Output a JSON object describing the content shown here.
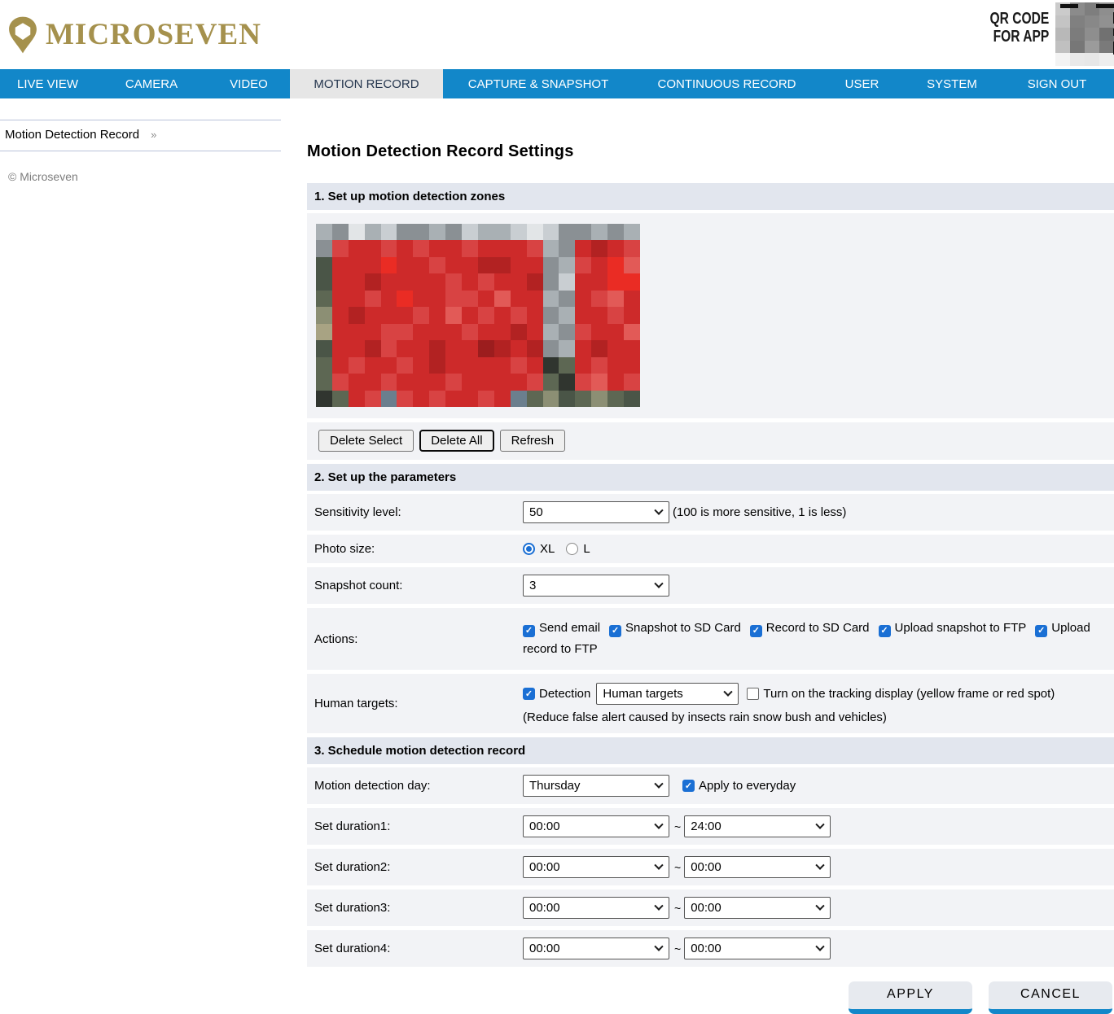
{
  "brand": {
    "name": "MICROSEVEN"
  },
  "qr": {
    "line1": "QR CODE",
    "line2": "FOR APP",
    "pixels": [
      [
        "#cbcbcb",
        "#8b8b8b",
        "#7e7e7e",
        "#8e8e8e"
      ],
      [
        "#c4c4c4",
        "#808080",
        "#888888",
        "#919191"
      ],
      [
        "#b8b8b8",
        "#7c7c7c",
        "#8e8e8e",
        "#717171"
      ],
      [
        "#c0c0c0",
        "#777777",
        "#9b9b9b",
        "#7a7a7a"
      ],
      [
        "#f3f3f3",
        "#e9e9e9",
        "#e7e7e7",
        "#eeeeee"
      ]
    ]
  },
  "nav": {
    "tabs": [
      {
        "id": "live-view",
        "label": "LIVE VIEW",
        "active": false
      },
      {
        "id": "camera",
        "label": "CAMERA",
        "active": false
      },
      {
        "id": "video",
        "label": "VIDEO",
        "active": false
      },
      {
        "id": "motion-record",
        "label": "MOTION RECORD",
        "active": true
      },
      {
        "id": "capture-snapshot",
        "label": "CAPTURE & SNAPSHOT",
        "active": false
      },
      {
        "id": "continuous-record",
        "label": "CONTINUOUS RECORD",
        "active": false
      },
      {
        "id": "user",
        "label": "USER",
        "active": false
      },
      {
        "id": "system",
        "label": "SYSTEM",
        "active": false
      },
      {
        "id": "sign-out",
        "label": "SIGN OUT",
        "active": false
      }
    ]
  },
  "sidebar": {
    "item_label": "Motion Detection Record",
    "chevron": "»",
    "copyright": "© Microseven"
  },
  "main": {
    "title": "Motion Detection Record Settings",
    "section1": {
      "title": "1. Set up motion detection zones",
      "zone_image": {
        "palette": {
          "a": "#8a9094",
          "b": "#a9b0b4",
          "c": "#c9ced2",
          "d": "#e2e5e7",
          "e": "#4a5547",
          "f": "#5d6753",
          "g": "#8c8f74",
          "h": "#30352f",
          "m": "#6b7f8e",
          "r": "#cd2a2a",
          "s": "#d84343",
          "t": "#b22222",
          "u": "#e25a57",
          "v": "#ea2c24",
          "w": "#9c1d1e",
          "y": "#a8a383"
        },
        "rows": [
          "badbcaabacbbcdcaabab",
          "asrrsrsrrsrrrsbartrs",
          "errrvrrsrrttrrabsrvu",
          "errtrrrrsrsrrtacrrvv",
          "frrsrvrrssrurrbarsur",
          "grtrrrsrursrsrabrrsr",
          "yrrrssrrrsrrtrbasrru",
          "errtsrrtrrwtrtabrtrr",
          "frsrrsrtrrrrsrhfrsrr",
          "fsrrsrrrsrrrrsfhsurs",
          "hfrsmsrsrrsrmfgefgfe"
        ]
      },
      "buttons": [
        {
          "id": "delete-select",
          "label": "Delete Select",
          "focused": false
        },
        {
          "id": "delete-all",
          "label": "Delete All",
          "focused": true
        },
        {
          "id": "refresh",
          "label": "Refresh",
          "focused": false
        }
      ]
    },
    "section2": {
      "title": "2. Set up the parameters",
      "sensitivity": {
        "label": "Sensitivity level:",
        "value": "50",
        "note": "(100 is more sensitive, 1 is less)"
      },
      "photo_size": {
        "label": "Photo size:",
        "options": [
          {
            "label": "XL",
            "selected": true
          },
          {
            "label": "L",
            "selected": false
          }
        ]
      },
      "snapshot_count": {
        "label": "Snapshot count:",
        "value": "3"
      },
      "actions": {
        "label": "Actions:",
        "checkboxes": [
          {
            "label": "Send email",
            "checked": true
          },
          {
            "label": "Snapshot to SD Card",
            "checked": true
          },
          {
            "label": "Record to SD Card",
            "checked": true
          },
          {
            "label": "Upload snapshot to FTP",
            "checked": true
          },
          {
            "label": "Upload record to FTP",
            "checked": true
          }
        ]
      },
      "human_targets": {
        "label": "Human targets:",
        "detection_checkbox": {
          "label": "Detection",
          "checked": true
        },
        "select_value": "Human targets",
        "tracking_checkbox": {
          "label": "Turn on the tracking display (yellow frame or red spot)",
          "checked": false
        },
        "note": "(Reduce false alert caused by insects rain snow bush and vehicles)"
      }
    },
    "section3": {
      "title": "3. Schedule motion detection record",
      "day": {
        "label": "Motion detection day:",
        "value": "Thursday",
        "everyday_checkbox": {
          "label": "Apply to everyday",
          "checked": true
        }
      },
      "tilde": "~",
      "durations": [
        {
          "label": "Set duration1:",
          "from": "00:00",
          "to": "24:00"
        },
        {
          "label": "Set duration2:",
          "from": "00:00",
          "to": "00:00"
        },
        {
          "label": "Set duration3:",
          "from": "00:00",
          "to": "00:00"
        },
        {
          "label": "Set duration4:",
          "from": "00:00",
          "to": "00:00"
        }
      ]
    },
    "footer_buttons": [
      {
        "id": "apply",
        "label": "APPLY"
      },
      {
        "id": "cancel",
        "label": "CANCEL"
      }
    ]
  },
  "colors": {
    "nav_blue": "#1287c9",
    "brand_gold": "#a5914d",
    "check_blue": "#1a6fd4",
    "section_header_bg": "#e2e6ee",
    "row_bg": "#f2f3f6"
  }
}
